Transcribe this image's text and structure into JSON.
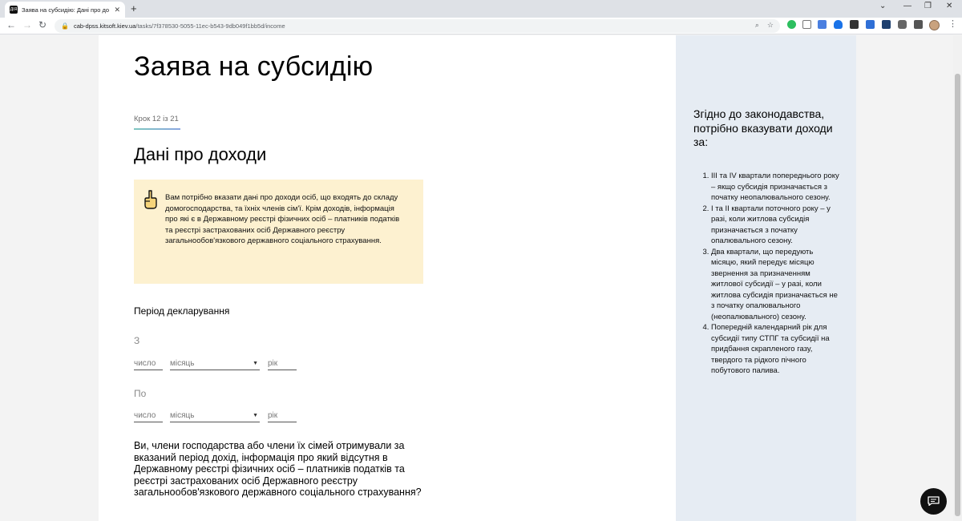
{
  "browser": {
    "tab_title": "Заява на субсидію: Дані про до",
    "favicon_text": "ДІЯ",
    "url_host": "cab-dpss.kitsoft.kiev.ua",
    "url_path": "/tasks/7f378530-5055-11ec-b543-9db049f1bb5d/income"
  },
  "page": {
    "title": "Заява на субсидію",
    "step": "Крок 12 із 21",
    "section_title": "Дані про доходи",
    "notice": "Вам потрібно вказати дані про доходи осіб, що входять до складу домогосподарства, та їхніх членів сім'ї. Крім доходів, інформація про які є в Державному реєстрі фізичних осіб – платників податків та реєстрі застрахованих осіб Державного реєстру загальнообов'язкового державного соціального страхування.",
    "period_label": "Період декларування",
    "from_label": "З",
    "to_label": "По",
    "date_fields": {
      "day_placeholder": "число",
      "month_placeholder": "місяць",
      "year_placeholder": "рік"
    },
    "question": "Ви, члени господарства або члени їх сімей отримували за вказаний період дохід, інформація про який відсутня в Державному реєстрі фізичних осіб – платників податків та реєстрі застрахованих осіб Державного реєстру загальнообов'язкового державного соціального страхування?"
  },
  "sidebar": {
    "title": "Згідно до законодавства, потрібно вказувати доходи за:",
    "items": [
      "ІІІ та IV квартали попереднього року – якщо субсидія призначається з початку неопалювального сезону.",
      "І та ІІ квартали поточного року – у разі, коли житлова субсидія призначається з початку опалювального сезону.",
      "Два квартали, що передують місяцю, який передує місяцю звернення за призначенням житлової субсидії – у разі, коли житлова субсидія призначається не з початку опалювального (неопалювального) сезону.",
      "Попередній календарний рік для субсидії типу СТПГ та субсидії на придбання скрапленого газу, твердого та рідкого пічного побутового палива."
    ]
  },
  "icons": {
    "notice": "pointing-hand-icon",
    "chat": "chat-icon"
  },
  "colors": {
    "notice_bg": "#fdf1d0",
    "sidebar_bg": "#e6ecf3"
  }
}
